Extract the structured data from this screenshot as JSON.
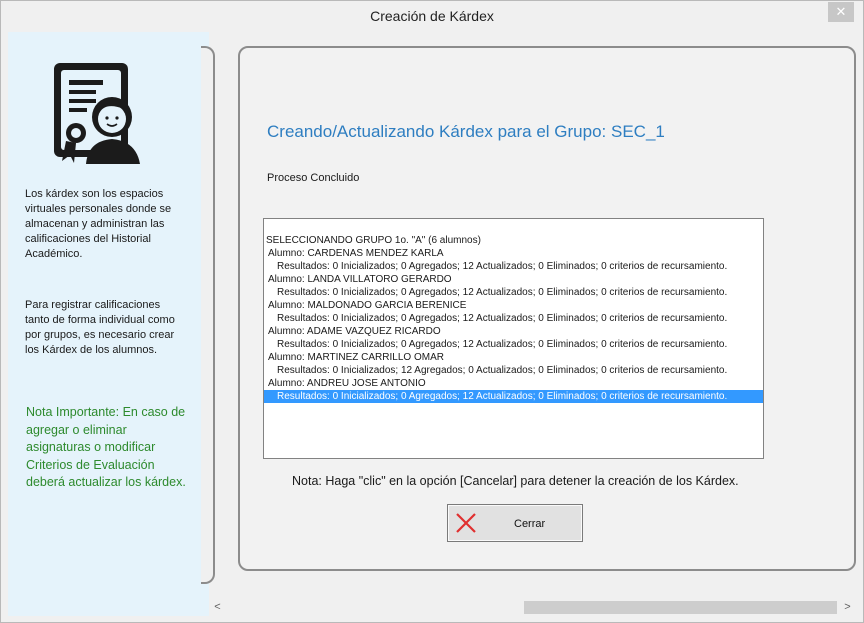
{
  "window": {
    "title": "Creación de Kárdex",
    "close_symbol": "✕"
  },
  "sidebar": {
    "icon": "kardex-certificate-user-icon",
    "paragraph_1": "Los kárdex son los espacios virtuales personales donde se almacenan y administran las calificaciones del Historial Académico.",
    "paragraph_2": "Para registrar calificaciones tanto de forma individual como por grupos, es necesario crear los Kárdex de los alumnos.",
    "important_note": "Nota Importante: En caso de agregar o eliminar asignaturas o modificar Criterios de Evaluación deberá actualizar los kárdex."
  },
  "main": {
    "heading": "Creando/Actualizando Kárdex para el Grupo: SEC_1",
    "status": "Proceso Concluido",
    "log": [
      "SELECCIONANDO GRUPO 1o. \"A\" (6 alumnos)",
      "Alumno: CARDENAS MENDEZ KARLA",
      "Resultados: 0 Inicializados; 0 Agregados; 12 Actualizados; 0 Eliminados; 0 criterios de recursamiento.",
      "Alumno: LANDA VILLATORO GERARDO",
      "Resultados: 0 Inicializados; 0 Agregados; 12 Actualizados; 0 Eliminados; 0 criterios de recursamiento.",
      "Alumno: MALDONADO GARCIA BERENICE",
      "Resultados: 0 Inicializados; 0 Agregados; 12 Actualizados; 0 Eliminados; 0 criterios de recursamiento.",
      "Alumno: ADAME VAZQUEZ  RICARDO",
      "Resultados: 0 Inicializados; 0 Agregados; 12 Actualizados; 0 Eliminados; 0 criterios de recursamiento.",
      "Alumno: MARTINEZ CARRILLO OMAR",
      "Resultados: 0 Inicializados; 12 Agregados; 0 Actualizados; 0 Eliminados; 0 criterios de recursamiento.",
      "Alumno: ANDREU  JOSE ANTONIO",
      "Resultados: 0 Inicializados; 0 Agregados; 12 Actualizados; 0 Eliminados; 0 criterios de recursamiento."
    ],
    "help_note": "Nota: Haga \"clic\" en la opción [Cancelar] para detener la creación de los Kárdex.",
    "close_button_label": "Cerrar",
    "close_button_icon": "red-x-icon"
  },
  "scrollbar": {
    "left_arrow": "<",
    "right_arrow": ">"
  },
  "colors": {
    "sidebar_bg": "#e5f3fb",
    "heading": "#2e7ec1",
    "important_note": "#2d8a2d",
    "selection": "#3399ff",
    "close_x": "#e03030"
  }
}
